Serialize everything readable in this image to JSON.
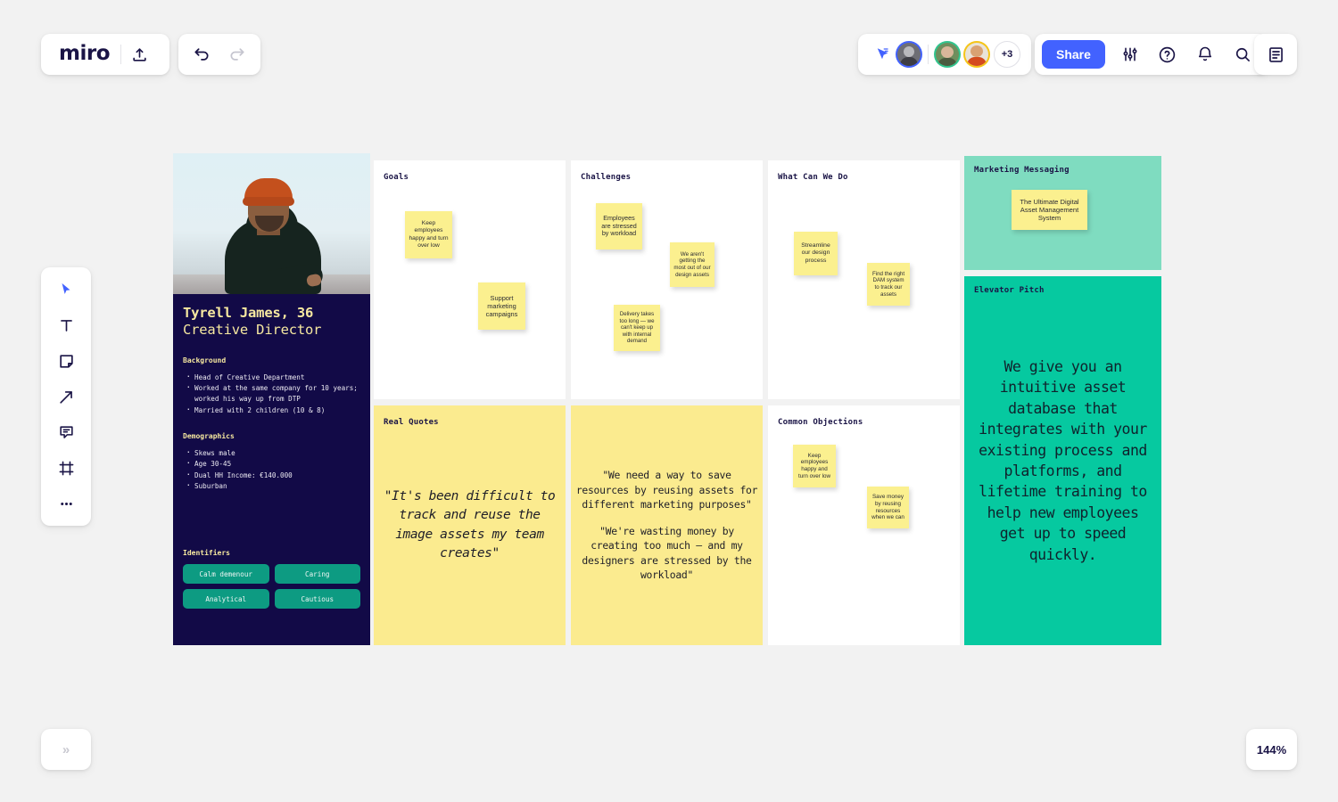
{
  "app": {
    "name": "miro",
    "zoom_level": "144%",
    "collapse_label": "»"
  },
  "toolbar_top": {
    "upload_icon": "upload-icon",
    "undo_icon": "undo-icon",
    "redo_icon": "redo-icon",
    "cursor_icon": "cursor-pointer-icon",
    "avatars_overflow": "+3",
    "share_label": "Share",
    "settings_icon": "sliders-icon",
    "help_icon": "question-circle-icon",
    "notifications_icon": "bell-icon",
    "search_icon": "search-icon",
    "panel_icon": "notes-panel-icon"
  },
  "toolbar_left": {
    "items": [
      {
        "name": "select-tool",
        "icon": "cursor-arrow-icon"
      },
      {
        "name": "text-tool",
        "icon": "text-t-icon"
      },
      {
        "name": "sticky-note-tool",
        "icon": "sticky-note-icon"
      },
      {
        "name": "arrow-tool",
        "icon": "arrow-diagonal-icon"
      },
      {
        "name": "comment-tool",
        "icon": "comment-bubble-icon"
      },
      {
        "name": "frame-tool",
        "icon": "frame-icon"
      },
      {
        "name": "more-tools",
        "icon": "ellipsis-icon"
      }
    ]
  },
  "persona": {
    "name": "Tyrell James, 36",
    "role": "Creative Director",
    "background_heading": "Background",
    "background_items": [
      "Head of Creative Department",
      "Worked at the same company for 10 years; worked his way up from DTP",
      "Married with 2 children (10 & 8)"
    ],
    "demographics_heading": "Demographics",
    "demographics_items": [
      "Skews male",
      "Age 30-45",
      "Dual HH Income: €140.000",
      "Suburban"
    ],
    "identifiers_heading": "Identifiers",
    "identifiers": [
      "Calm demenour",
      "Caring",
      "Analytical",
      "Cautious"
    ]
  },
  "panels": {
    "goals": {
      "title": "Goals",
      "notes": [
        "Keep employees happy and turn over low",
        "Support marketing campaigns"
      ]
    },
    "challenges": {
      "title": "Challenges",
      "notes": [
        "Employees are stressed by workload",
        "We aren't getting the most out of our design assets",
        "Delivery takes too long — we can't keep up with internal demand"
      ]
    },
    "what_can_we_do": {
      "title": "What Can We Do",
      "notes": [
        "Streamline our design process",
        "Find the right DAM system to track our assets"
      ]
    },
    "marketing_messaging": {
      "title": "Marketing Messaging",
      "notes": [
        "The Ultimate Digital Asset Management System"
      ]
    },
    "elevator_pitch": {
      "title": "Elevator Pitch",
      "text": "We give you an intuitive asset database that integrates with your existing process and platforms, and lifetime training to help new employees get up to speed quickly."
    },
    "real_quotes": {
      "title": "Real Quotes",
      "quote": "\"It's been difficult to track and reuse the image assets my team creates\""
    },
    "quotes_secondary": {
      "quote_1": "\"We need a way to save resources by reusing assets for different marketing purposes\"",
      "quote_2": "\"We're wasting money by creating too much — and my designers are stressed by the workload\""
    },
    "common_objections": {
      "title": "Common Objections",
      "notes": [
        "Keep employees happy and turn over low",
        "Save money by reusing resources when we can"
      ]
    }
  },
  "colors": {
    "brand_blue": "#4262ff",
    "persona_navy": "#120a47",
    "tag_teal": "#0d9b82",
    "sticky_yellow": "#fbf08f",
    "panel_yellow": "#fbeb8f",
    "mint": "#7fdcc0",
    "teal": "#06c9a0",
    "canvas": "#f2f2f2"
  }
}
